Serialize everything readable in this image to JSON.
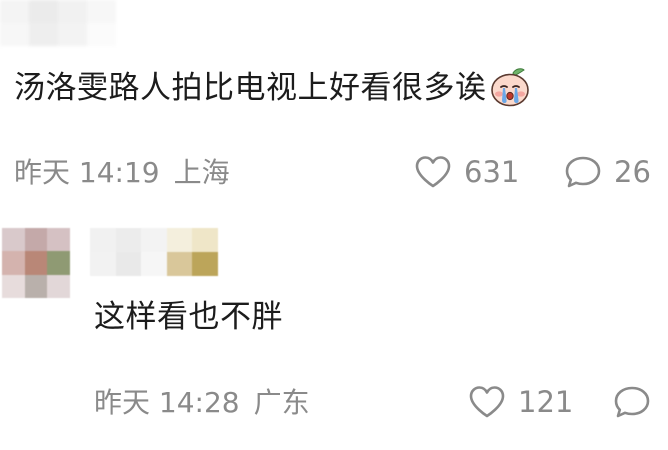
{
  "comments": [
    {
      "text": "汤洛雯路人拍比电视上好看很多诶",
      "sticker": "crying-face-sticker",
      "time": "昨天 14:19",
      "location": "上海",
      "likes": "631",
      "replies": "26"
    },
    {
      "text": "这样看也不胖",
      "time": "昨天 14:28",
      "location": "广东",
      "likes": "121"
    }
  ],
  "icons": {
    "like": "heart-outline-icon",
    "reply": "speech-bubble-icon"
  },
  "colors": {
    "text": "#1c1c1c",
    "meta": "#8a8a8a",
    "background": "#ffffff"
  }
}
